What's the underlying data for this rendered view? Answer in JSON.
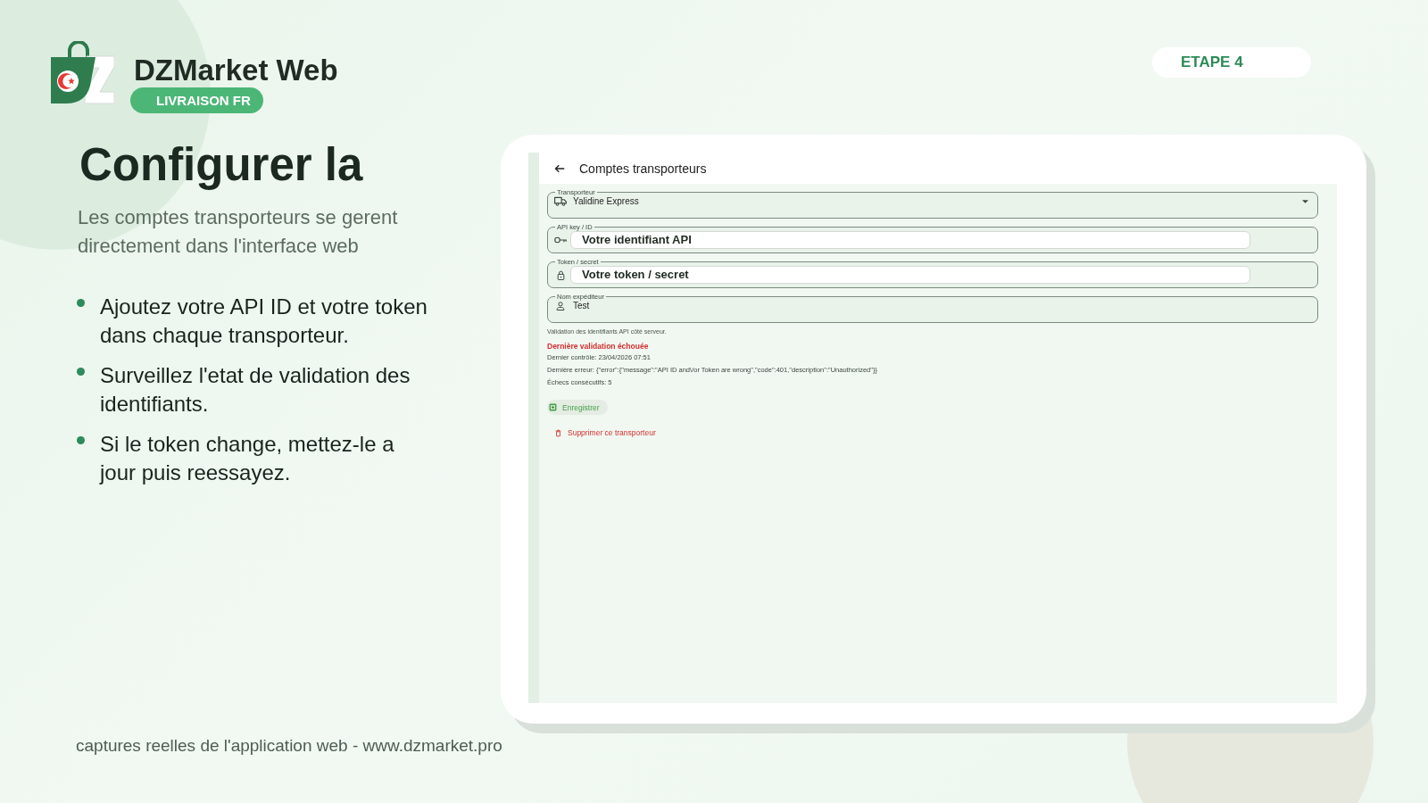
{
  "brand": {
    "name": "DZMarket Web",
    "tagline": "LIVRAISON FR"
  },
  "step_badge": {
    "label": "ETAPE 4"
  },
  "headline": "Configurer la",
  "subtitle": "Les comptes transporteurs se gerent directement dans l'interface web",
  "bullets": [
    "Ajoutez votre API ID et votre token dans chaque transporteur.",
    "Surveillez l'etat de validation des identifiants.",
    "Si le token change, mettez-le a jour puis reessayez."
  ],
  "app_screen": {
    "header": {
      "title": "Comptes transporteurs"
    },
    "fields": [
      {
        "kind": "select",
        "label": "Transporteur",
        "value": "Yalidine Express"
      },
      {
        "kind": "text",
        "label": "API key / ID",
        "overlay": "Votre identifiant API"
      },
      {
        "kind": "text",
        "label": "Token / secret",
        "overlay": "Votre token / secret"
      },
      {
        "kind": "text",
        "label": "Nom expéditeur",
        "value": "Test"
      }
    ],
    "help_text": "Validation des identifiants API côté serveur.",
    "validation": {
      "title": "Dernière validation échouée",
      "failed": true,
      "details": [
        "Dernier contrôle: 23/04/2026 07:51",
        "Dernière erreur: {\"error\":{\"message\":\"API ID and\\/or Token are wrong\",\"code\":401,\"description\":\"Unauthorized\"}}",
        "Échecs consécutifs: 5"
      ]
    },
    "actions": [
      {
        "kind": "save",
        "label": "Enregistrer"
      },
      {
        "kind": "delete",
        "label": "Supprimer ce transporteur"
      }
    ]
  },
  "footer": "captures reelles de l'application web - www.dzmarket.pro"
}
